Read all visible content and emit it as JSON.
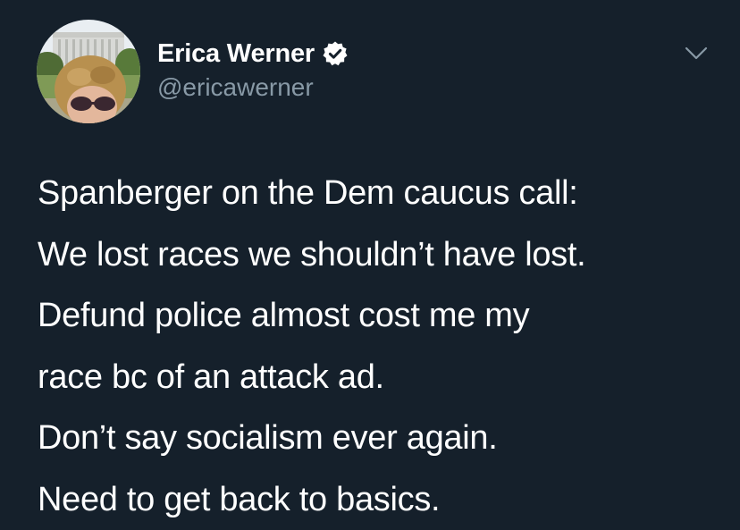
{
  "tweet": {
    "author": {
      "display_name": "Erica Werner",
      "handle": "@ericawerner",
      "verified": true,
      "avatar_icon": "profile-photo-avatar",
      "verified_icon": "verified-badge-icon"
    },
    "menu_icon": "chevron-down-icon",
    "lines": [
      "Spanberger on the Dem caucus call:",
      "We lost races we shouldn’t have lost.",
      "Defund police almost cost me my",
      "race bc of an attack ad.",
      "Don’t say socialism ever again.",
      "Need to get back to basics."
    ]
  },
  "colors": {
    "background": "#15202b",
    "primary_text": "#ffffff",
    "secondary_text": "#8899a6",
    "caret": "#8899a6"
  }
}
